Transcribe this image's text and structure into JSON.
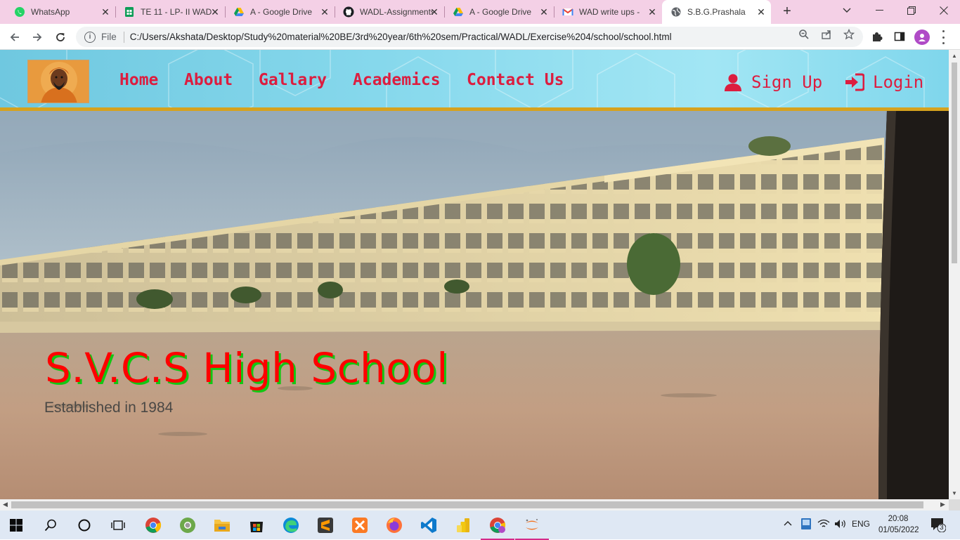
{
  "browser": {
    "tabs": [
      {
        "title": "WhatsApp",
        "icon": "whatsapp-icon",
        "active": false
      },
      {
        "title": "TE 11 - LP- II WAD",
        "icon": "sheets-icon",
        "active": false
      },
      {
        "title": "A - Google Drive",
        "icon": "google-drive-icon",
        "active": false
      },
      {
        "title": "WADL-Assignments",
        "icon": "github-icon",
        "active": false
      },
      {
        "title": "A - Google Drive",
        "icon": "google-drive-icon",
        "active": false
      },
      {
        "title": "WAD write ups -",
        "icon": "gmail-icon",
        "active": false
      },
      {
        "title": "S.B.G.Prashala",
        "icon": "globe-icon",
        "active": true
      }
    ],
    "address": {
      "scheme_label": "File",
      "url": "C:/Users/Akshata/Desktop/Study%20material%20BE/3rd%20year/6th%20sem/Practical/WADL/Exercise%204/school/school.html"
    }
  },
  "site": {
    "nav": [
      "Home",
      "About",
      "Gallary",
      "Academics",
      "Contact Us"
    ],
    "signup_label": "Sign Up",
    "login_label": "Login",
    "colors": {
      "nav_text": "#dc1d3f",
      "header_bg": "#86d8ec",
      "header_border": "#d6a21e",
      "title": "#ff0000",
      "title_shadow": "#13c713"
    }
  },
  "hero": {
    "title": "S.V.C.S High School",
    "subtitle": "Established in 1984"
  },
  "taskbar": {
    "language": "ENG",
    "time": "20:08",
    "date": "01/05/2022",
    "notification_count": "3"
  }
}
